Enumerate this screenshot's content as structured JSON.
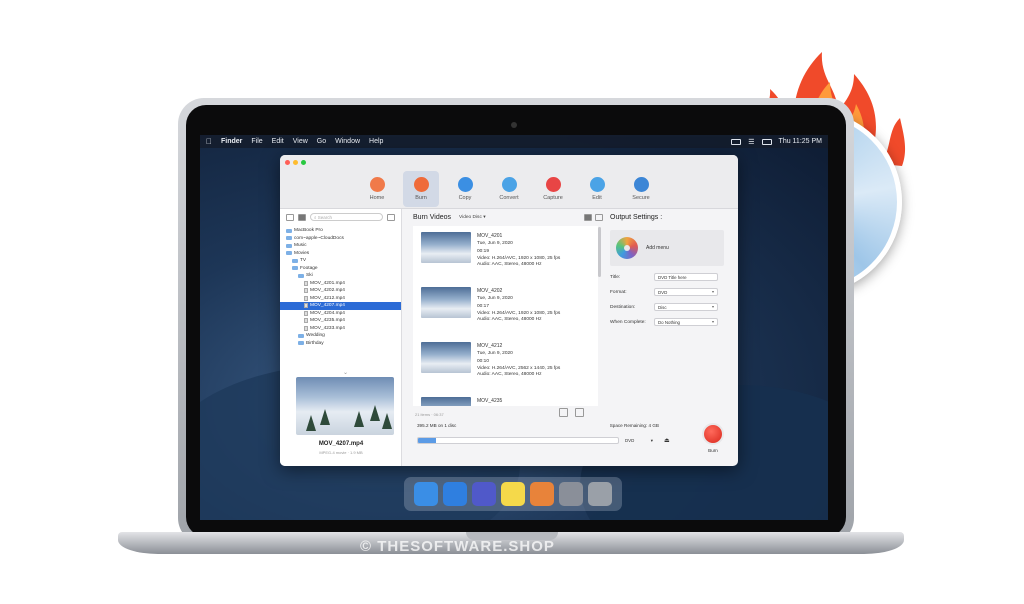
{
  "menubar": {
    "app": "Finder",
    "items": [
      "File",
      "Edit",
      "View",
      "Go",
      "Window",
      "Help"
    ],
    "clock": "Thu 11:25 PM"
  },
  "toolbar": {
    "buttons": [
      {
        "label": "Home",
        "icon": "home-icon",
        "color": "#f07a4a"
      },
      {
        "label": "Burn",
        "icon": "burn-icon",
        "color": "#ef6b3a"
      },
      {
        "label": "Copy",
        "icon": "copy-icon",
        "color": "#3b8fe3"
      },
      {
        "label": "Convert",
        "icon": "convert-icon",
        "color": "#4ba3e6"
      },
      {
        "label": "Capture",
        "icon": "capture-icon",
        "color": "#e84545"
      },
      {
        "label": "Edit",
        "icon": "edit-icon",
        "color": "#4ba3e6"
      },
      {
        "label": "Secure",
        "icon": "secure-icon",
        "color": "#3c86d6"
      }
    ],
    "active": "Burn"
  },
  "browser": {
    "search_placeholder": "Search",
    "tree": [
      {
        "label": "MacBook Pro",
        "depth": 0,
        "type": "folder"
      },
      {
        "label": "com~apple~CloudDocs",
        "depth": 0,
        "type": "folder"
      },
      {
        "label": "Music",
        "depth": 0,
        "type": "folder"
      },
      {
        "label": "Movies",
        "depth": 0,
        "type": "folder"
      },
      {
        "label": "TV",
        "depth": 1,
        "type": "folder"
      },
      {
        "label": "Footage",
        "depth": 1,
        "type": "folder"
      },
      {
        "label": "Ski",
        "depth": 2,
        "type": "folder"
      },
      {
        "label": "MOV_4201.mp4",
        "depth": 3,
        "type": "file"
      },
      {
        "label": "MOV_4202.mp4",
        "depth": 3,
        "type": "file"
      },
      {
        "label": "MOV_4212.mp4",
        "depth": 3,
        "type": "file"
      },
      {
        "label": "MOV_4207.mp4",
        "depth": 3,
        "type": "file",
        "selected": true
      },
      {
        "label": "MOV_4204.mp4",
        "depth": 3,
        "type": "file"
      },
      {
        "label": "MOV_4235.mp4",
        "depth": 3,
        "type": "file"
      },
      {
        "label": "MOV_4233.mp4",
        "depth": 3,
        "type": "file"
      },
      {
        "label": "Wedding",
        "depth": 2,
        "type": "folder"
      },
      {
        "label": "Birthday",
        "depth": 2,
        "type": "folder"
      }
    ],
    "preview_name": "MOV_4207.mp4",
    "preview_meta": "MPEG-4 movie · 1.9 MB"
  },
  "burn": {
    "title": "Burn Videos",
    "disc_type": "Video Disc",
    "items": [
      {
        "name": "MOV_4201",
        "date": "Tue, Jun 9, 2020",
        "duration": "00:19",
        "video": "Video: H.264/AVC, 1920 x 1080, 25 fps",
        "audio": "Audio: AAC, Stereo, 48000 Hz"
      },
      {
        "name": "MOV_4202",
        "date": "Tue, Jun 9, 2020",
        "duration": "00:17",
        "video": "Video: H.264/AVC, 1920 x 1080, 25 fps",
        "audio": "Audio: AAC, Stereo, 48000 Hz"
      },
      {
        "name": "MOV_4212",
        "date": "Tue, Jun 9, 2020",
        "duration": "00:10",
        "video": "Video: H.264/AVC, 2562 x 1440, 25 fps",
        "audio": "Audio: AAC, Stereo, 48000 Hz"
      },
      {
        "name": "MOV_4235",
        "date": "Tue, Jun 9, 2020",
        "duration": "",
        "video": "",
        "audio": ""
      }
    ],
    "count": "21 items · 06:37",
    "size_used": "395.2 MB on 1 disc",
    "space_remaining": "Space Remaining: 4 GB",
    "progress_fraction": 0.09,
    "device": "DVD",
    "burn_label": "Burn"
  },
  "output": {
    "title": "Output Settings :",
    "add_menu": "Add menu",
    "fields": [
      {
        "label": "Title:",
        "value": "DVD Title here",
        "type": "text"
      },
      {
        "label": "Format:",
        "value": "DVD",
        "type": "select"
      },
      {
        "label": "Destination:",
        "value": "Disc",
        "type": "select"
      },
      {
        "label": "When Complete:",
        "value": "Do Nothing",
        "type": "select"
      }
    ]
  },
  "dock": {
    "apps": [
      {
        "name": "finder-icon",
        "color": "#3a8ee6"
      },
      {
        "name": "safari-icon",
        "color": "#2f7fe0"
      },
      {
        "name": "teams-icon",
        "color": "#5059c9"
      },
      {
        "name": "notes-icon",
        "color": "#f5d94a"
      },
      {
        "name": "store-icon",
        "color": "#e8833a"
      },
      {
        "name": "preferences-icon",
        "color": "#8a8f99"
      },
      {
        "name": "trash-icon",
        "color": "#9aa0a8"
      }
    ]
  },
  "watermark": "© THESOFTWARE.SHOP"
}
